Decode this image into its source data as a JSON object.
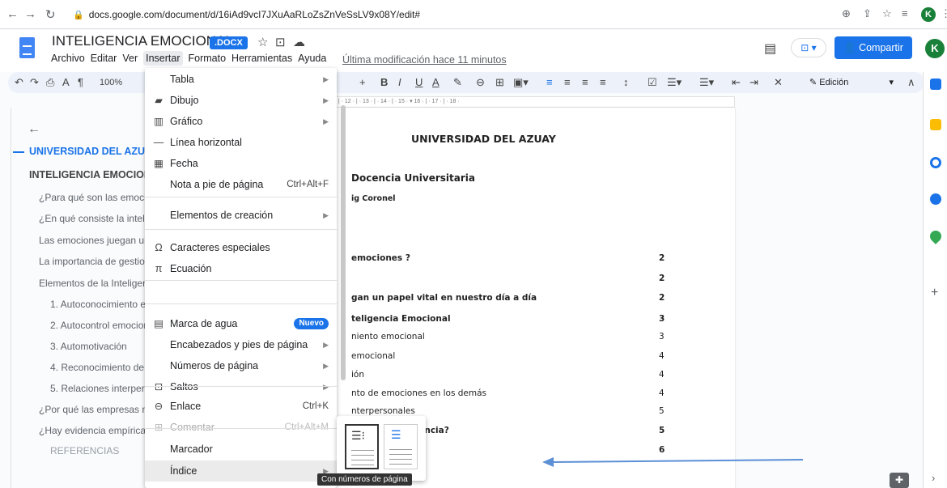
{
  "browser": {
    "url": "docs.google.com/document/d/16iAd9vcI7JXuAaRLoZsZnVeSsLV9x08Y/edit#",
    "avatar": "K"
  },
  "doc": {
    "title": "INTELIGENCIA EMOCIONAL",
    "format_badge": ".DOCX",
    "last_modified": "Última modificación hace 11 minutos",
    "share_label": "Compartir",
    "avatar": "K",
    "edit_mode": "Edición",
    "zoom": "100%"
  },
  "menubar": [
    "Archivo",
    "Editar",
    "Ver",
    "Insertar",
    "Formato",
    "Herramientas",
    "Ayuda"
  ],
  "outline": {
    "items": [
      "UNIVERSIDAD DEL AZUA",
      "INTELIGENCIA EMOCION",
      "¿Para qué son las emocio",
      "¿En qué consiste la intelig",
      "Las emociones juegan un",
      "La importancia de gestior",
      "Elementos de la Inteligenc",
      "1. Autoconocimiento er",
      "2. Autocontrol emocior",
      "3. Automotivación",
      "4. Reconocimiento de e",
      "5. Relaciones interpers",
      "¿Por qué las empresas ne",
      "¿Hay evidencia empírica c",
      "REFERENCIAS"
    ]
  },
  "insert_menu": {
    "items": [
      {
        "label": "Tabla",
        "icon": "",
        "shortcut": "",
        "submenu": true
      },
      {
        "label": "Dibujo",
        "icon": "drawing-icon",
        "shortcut": "",
        "submenu": true
      },
      {
        "label": "Gráfico",
        "icon": "chart-icon",
        "shortcut": "",
        "submenu": true
      },
      {
        "label": "Línea horizontal",
        "icon": "horizontal-line-icon",
        "shortcut": "",
        "submenu": false
      },
      {
        "label": "Fecha",
        "icon": "calendar-icon",
        "shortcut": "",
        "submenu": false
      },
      {
        "label": "Nota a pie de página",
        "icon": "",
        "shortcut": "Ctrl+Alt+F",
        "submenu": false
      },
      {
        "label": "Elementos de creación",
        "icon": "",
        "shortcut": "",
        "submenu": true
      },
      {
        "label": "Caracteres especiales",
        "icon": "omega-icon",
        "shortcut": "",
        "submenu": false
      },
      {
        "label": "Ecuación",
        "icon": "pi-icon",
        "shortcut": "",
        "submenu": false
      },
      {
        "label": "Marca de agua",
        "icon": "watermark-icon",
        "badge": "Nuevo",
        "shortcut": "",
        "submenu": false
      },
      {
        "label": "Encabezados y pies de página",
        "icon": "",
        "shortcut": "",
        "submenu": true
      },
      {
        "label": "Números de página",
        "icon": "",
        "shortcut": "",
        "submenu": true
      },
      {
        "label": "Saltos",
        "icon": "break-icon",
        "shortcut": "",
        "submenu": true
      },
      {
        "label": "Enlace",
        "icon": "link-icon",
        "shortcut": "Ctrl+K",
        "submenu": false
      },
      {
        "label": "Comentar",
        "icon": "comment-icon",
        "shortcut": "Ctrl+Alt+M",
        "submenu": false,
        "disabled": true
      },
      {
        "label": "Marcador",
        "icon": "",
        "shortcut": "",
        "submenu": false
      },
      {
        "label": "Índice",
        "icon": "",
        "shortcut": "",
        "submenu": true,
        "highlighted": true
      }
    ]
  },
  "tooltip": "Con números de página",
  "page": {
    "heading": "UNIVERSIDAD DEL AZUAY",
    "subheading": "Docencia Universitaria",
    "author": "ig Coronel",
    "toc": [
      {
        "text": "emociones ?",
        "page": "2",
        "bold": true
      },
      {
        "text": "",
        "page": "2",
        "bold": true
      },
      {
        "text": "gan un papel vital en nuestro día a día",
        "page": "2",
        "bold": true
      },
      {
        "text": "teligencia Emocional",
        "page": "3",
        "bold": true
      },
      {
        "text": "niento emocional",
        "page": "3",
        "bold": false
      },
      {
        "text": "emocional",
        "page": "4",
        "bold": false
      },
      {
        "text": "ión",
        "page": "4",
        "bold": false
      },
      {
        "text": "nto de emociones en los demás",
        "page": "4",
        "bold": false
      },
      {
        "text": "nterpersonales",
        "page": "5",
        "bold": false
      },
      {
        "text": "tipo de inteligencia?",
        "page": "5",
        "bold": true
      },
      {
        "text": "nga?",
        "page": "6",
        "bold": true
      }
    ]
  },
  "ruler_ticks": "· 1 · | · 4 · | · 5 · | · 6 · | · 7 · | · 8 · | · 9 · | · 10 · | · 11 · | · 12 · | · 13 · | · 14 · | · 15 · ▾ 16 · | · 17 · | · 18 ·",
  "colors": {
    "accent": "#1a73e8",
    "arrow": "#5b8fd6"
  }
}
